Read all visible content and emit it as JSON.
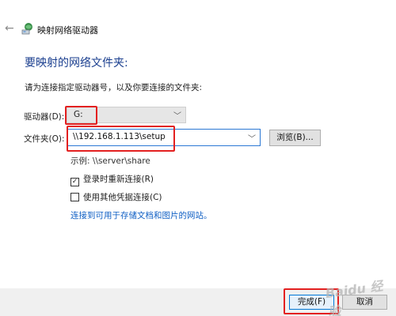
{
  "window": {
    "title": "映射网络驱动器"
  },
  "heading": "要映射的网络文件夹:",
  "description": "请为连接指定驱动器号，以及你要连接的文件夹:",
  "drive": {
    "label": "驱动器(D):",
    "value": "G:"
  },
  "folder": {
    "label": "文件夹(O):",
    "value": "\\\\192.168.1.113\\setup"
  },
  "browse_label": "浏览(B)...",
  "example": "示例: \\\\server\\share",
  "reconnect": {
    "label": "登录时重新连接(R)",
    "checked": true
  },
  "other_credentials": {
    "label": "使用其他凭据连接(C)",
    "checked": false
  },
  "link_text": "连接到可用于存储文档和图片的网站。",
  "footer": {
    "finish_label": "完成(F)",
    "cancel_label": "取消"
  },
  "watermark": "Baidu 经验",
  "colors": {
    "heading": "#1b3f8f",
    "link": "#0f5fc4",
    "annotation": "#e32020",
    "focus_border": "#2b78d4"
  }
}
